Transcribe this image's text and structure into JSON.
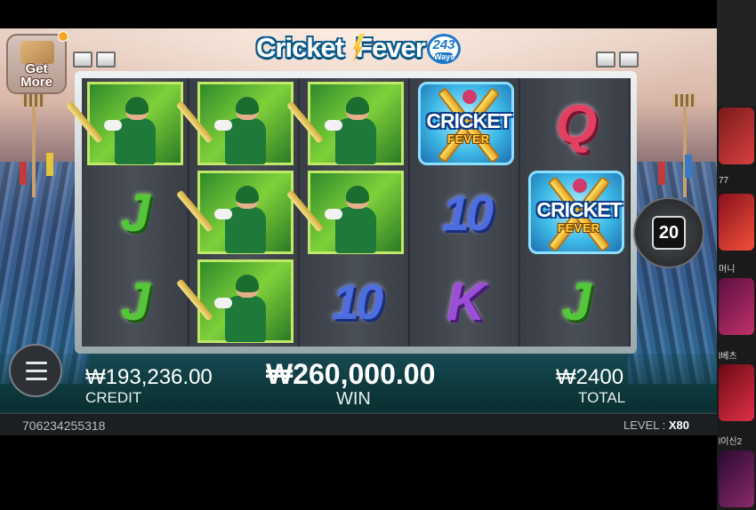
{
  "game": {
    "title_word1": "Cricket",
    "title_word2": "Fever",
    "ways_number": "243",
    "ways_label": "Ways"
  },
  "get_more": {
    "label_line1": "Get",
    "label_line2": "More"
  },
  "reels": [
    [
      "player",
      "J",
      "J"
    ],
    [
      "player",
      "player",
      "player"
    ],
    [
      "player",
      "player",
      "10"
    ],
    [
      "scatter",
      "10",
      "K"
    ],
    [
      "Q",
      "scatter",
      "J"
    ]
  ],
  "scatter_symbol": {
    "line1": "CRICKET",
    "line2": "FEVER"
  },
  "autospin": {
    "count": "20"
  },
  "info": {
    "credit_value": "₩193,236.00",
    "credit_label": "CREDIT",
    "win_value": "₩260,000.00",
    "win_label": "WIN",
    "total_value": "₩2400",
    "total_label": "TOTAL"
  },
  "status": {
    "game_id": "706234255318",
    "level_label": "LEVEL :",
    "level_value": "X80"
  },
  "side_labels": [
    "77",
    "머니",
    "l베츠",
    "l이신2"
  ],
  "colors": {
    "player_bg": "#5cb832",
    "J": "#53c63a",
    "10": "#4d6de0",
    "K": "#9b4fd8",
    "Q": "#e23f62",
    "scatter_bg": "#3db8e6"
  }
}
